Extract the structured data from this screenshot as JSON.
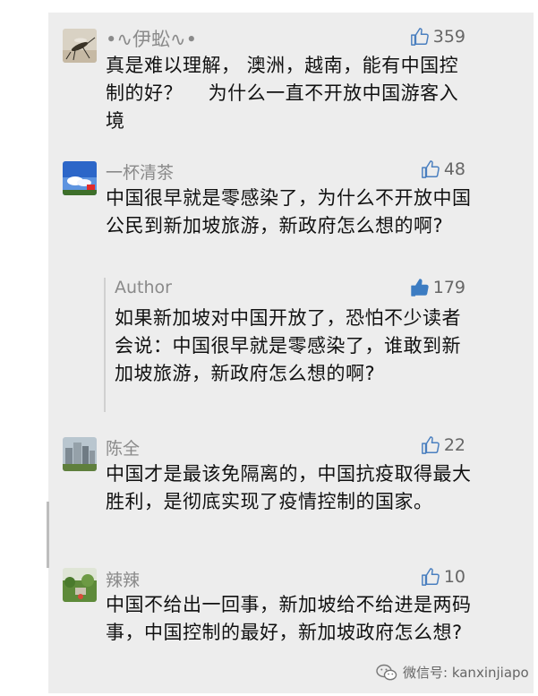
{
  "comments": [
    {
      "name": "•∿伊蚣∿•",
      "likes": "359",
      "text": "真是难以理解， 澳洲，越南，能有中国控制的好？　 为什么一直不开放中国游客入境",
      "avatar": "mosquito-avatar"
    },
    {
      "name": "一杯清茶",
      "likes": "48",
      "text": "中国很早就是零感染了，为什么不开放中国公民到新加坡旅游，新政府怎么想的啊?",
      "avatar": "sky-flag-avatar",
      "reply": {
        "name": "Author",
        "likes": "179",
        "text": "如果新加坡对中国开放了，恐怕不少读者会说：中国很早就是零感染了，谁敢到新加坡旅游，新政府怎么想的啊?"
      }
    },
    {
      "name": "陈全",
      "likes": "22",
      "text": "中国才是最该免隔离的，中国抗疫取得最大胜利，是彻底实现了疫情控制的国家。",
      "avatar": "city-avatar"
    },
    {
      "name": "辣辣",
      "likes": "10",
      "text": "中国不给出一回事，新加坡给不给进是两码事，中国控制的最好，新加坡政府怎么想?",
      "avatar": "garden-avatar"
    }
  ],
  "watermark": {
    "label": "微信号: kanxinjiapo",
    "icon": "wechat-icon"
  },
  "colors": {
    "panel_bg": "#ededed",
    "name": "#8a8a8a",
    "text": "#111111",
    "reply_thumb": "#3c7cc2"
  }
}
